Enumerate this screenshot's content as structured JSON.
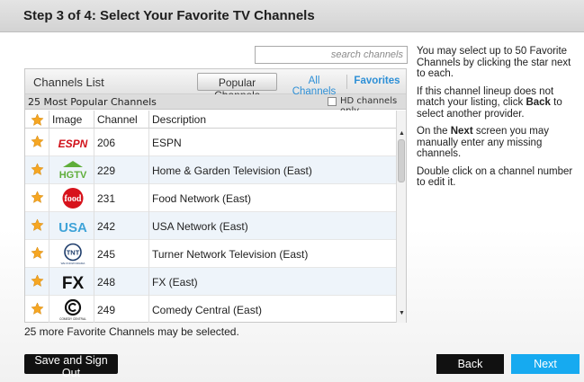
{
  "header": {
    "title": "Step 3 of 4: Select Your Favorite TV Channels"
  },
  "search": {
    "placeholder": "search channels"
  },
  "panel": {
    "title": "Channels List",
    "tabs": {
      "popular": "Popular Channels",
      "all": "All Channels",
      "favorites": "Favorites"
    },
    "subtitle": "25 Most Popular Channels",
    "hd_label": "HD channels only",
    "columns": [
      "Image",
      "Channel",
      "Description"
    ]
  },
  "rows": [
    {
      "logo": "ESPN logo",
      "channel": "206",
      "description": "ESPN"
    },
    {
      "logo": "HGTV logo",
      "channel": "229",
      "description": "Home & Garden Television (East)"
    },
    {
      "logo": "Food Network logo",
      "channel": "231",
      "description": "Food Network (East)"
    },
    {
      "logo": "USA Network logo",
      "channel": "242",
      "description": "USA Network (East)"
    },
    {
      "logo": "TNT logo",
      "channel": "245",
      "description": "Turner Network Television (East)"
    },
    {
      "logo": "FX logo",
      "channel": "248",
      "description": "FX (East)"
    },
    {
      "logo": "Comedy Central logo",
      "channel": "249",
      "description": "Comedy Central (East)"
    }
  ],
  "logo_text": {
    "espn": "ESPN",
    "hgtv": "HGTV",
    "food": "food",
    "usa": "USA",
    "tnt": "TNT",
    "tnt_sub": "WE KNOW DRAMA",
    "fx": "FX",
    "cc_sub": "COMEDY CENTRAL"
  },
  "status": {
    "remaining": "25 more Favorite Channels may be selected."
  },
  "help": {
    "p1": "You may select up to 50 Favorite Channels by clicking the star next to each.",
    "p2_before": "If this channel lineup does not match your listing, click ",
    "p2_bold": "Back",
    "p2_after": " to select another provider.",
    "p3_before": "On the ",
    "p3_bold": "Next",
    "p3_after": " screen you may manually enter any missing channels.",
    "p4": "Double click on a channel number to edit it."
  },
  "buttons": {
    "save": "Save and Sign Out",
    "back": "Back",
    "next": "Next"
  },
  "colors": {
    "star": "#f5a623",
    "next_button": "#16aaf0",
    "link": "#2d8fd6",
    "row_alt": "#eef4fa"
  },
  "icons": {
    "star": "star-icon",
    "hd_checkbox": "checkbox",
    "scroll_up": "scroll-up-arrow",
    "scroll_down": "scroll-down-arrow"
  }
}
